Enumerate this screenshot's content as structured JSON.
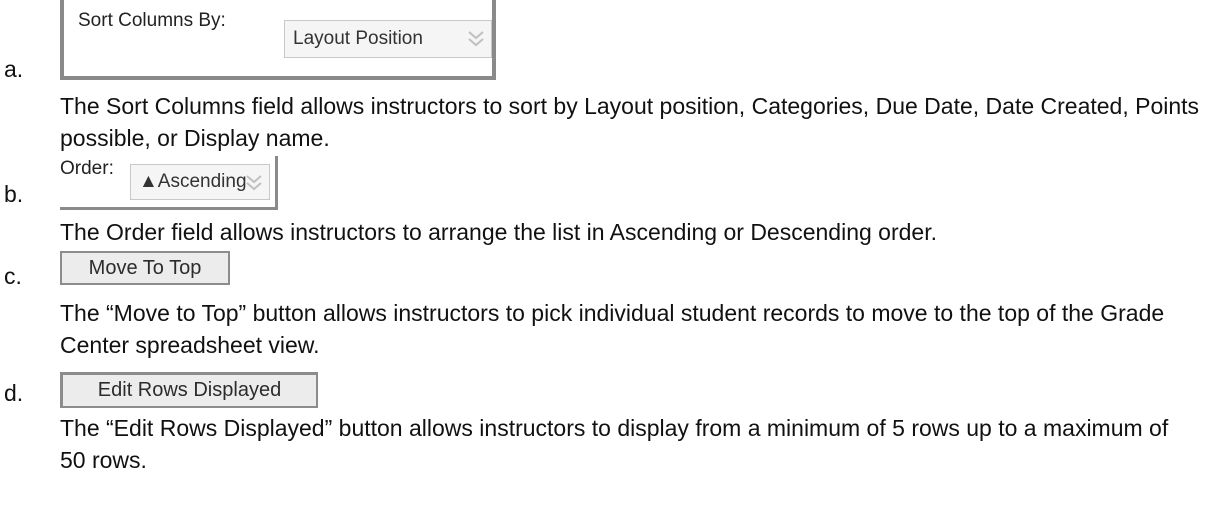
{
  "items": [
    {
      "marker": "a.",
      "widget": {
        "label": "Sort Columns By:",
        "value": "Layout Position"
      },
      "description": "The Sort Columns field allows instructors to sort by Layout position, Categories, Due Date, Date Created, Points possible, or Display name."
    },
    {
      "marker": "b.",
      "widget": {
        "label": "Order:",
        "value": "▲Ascending"
      },
      "description": "The Order field allows instructors to arrange the list in Ascending or Descending order."
    },
    {
      "marker": "c.",
      "widget": {
        "button_label": "Move To Top"
      },
      "description": "The “Move to Top” button allows instructors to pick individual student records to move to the top of the Grade Center spreadsheet view."
    },
    {
      "marker": "d.",
      "widget": {
        "button_label": "Edit Rows Displayed"
      },
      "description": "The “Edit Rows Displayed” button allows instructors to display from a minimum of 5 rows up to a maximum of 50 rows."
    }
  ],
  "colors": {
    "frame_border": "#8a8a8a",
    "select_bg": "#f5f5f5",
    "button_bg": "#ececec",
    "chevron": "#c0c0c0"
  },
  "icons": [
    "chevron-down-icon"
  ]
}
